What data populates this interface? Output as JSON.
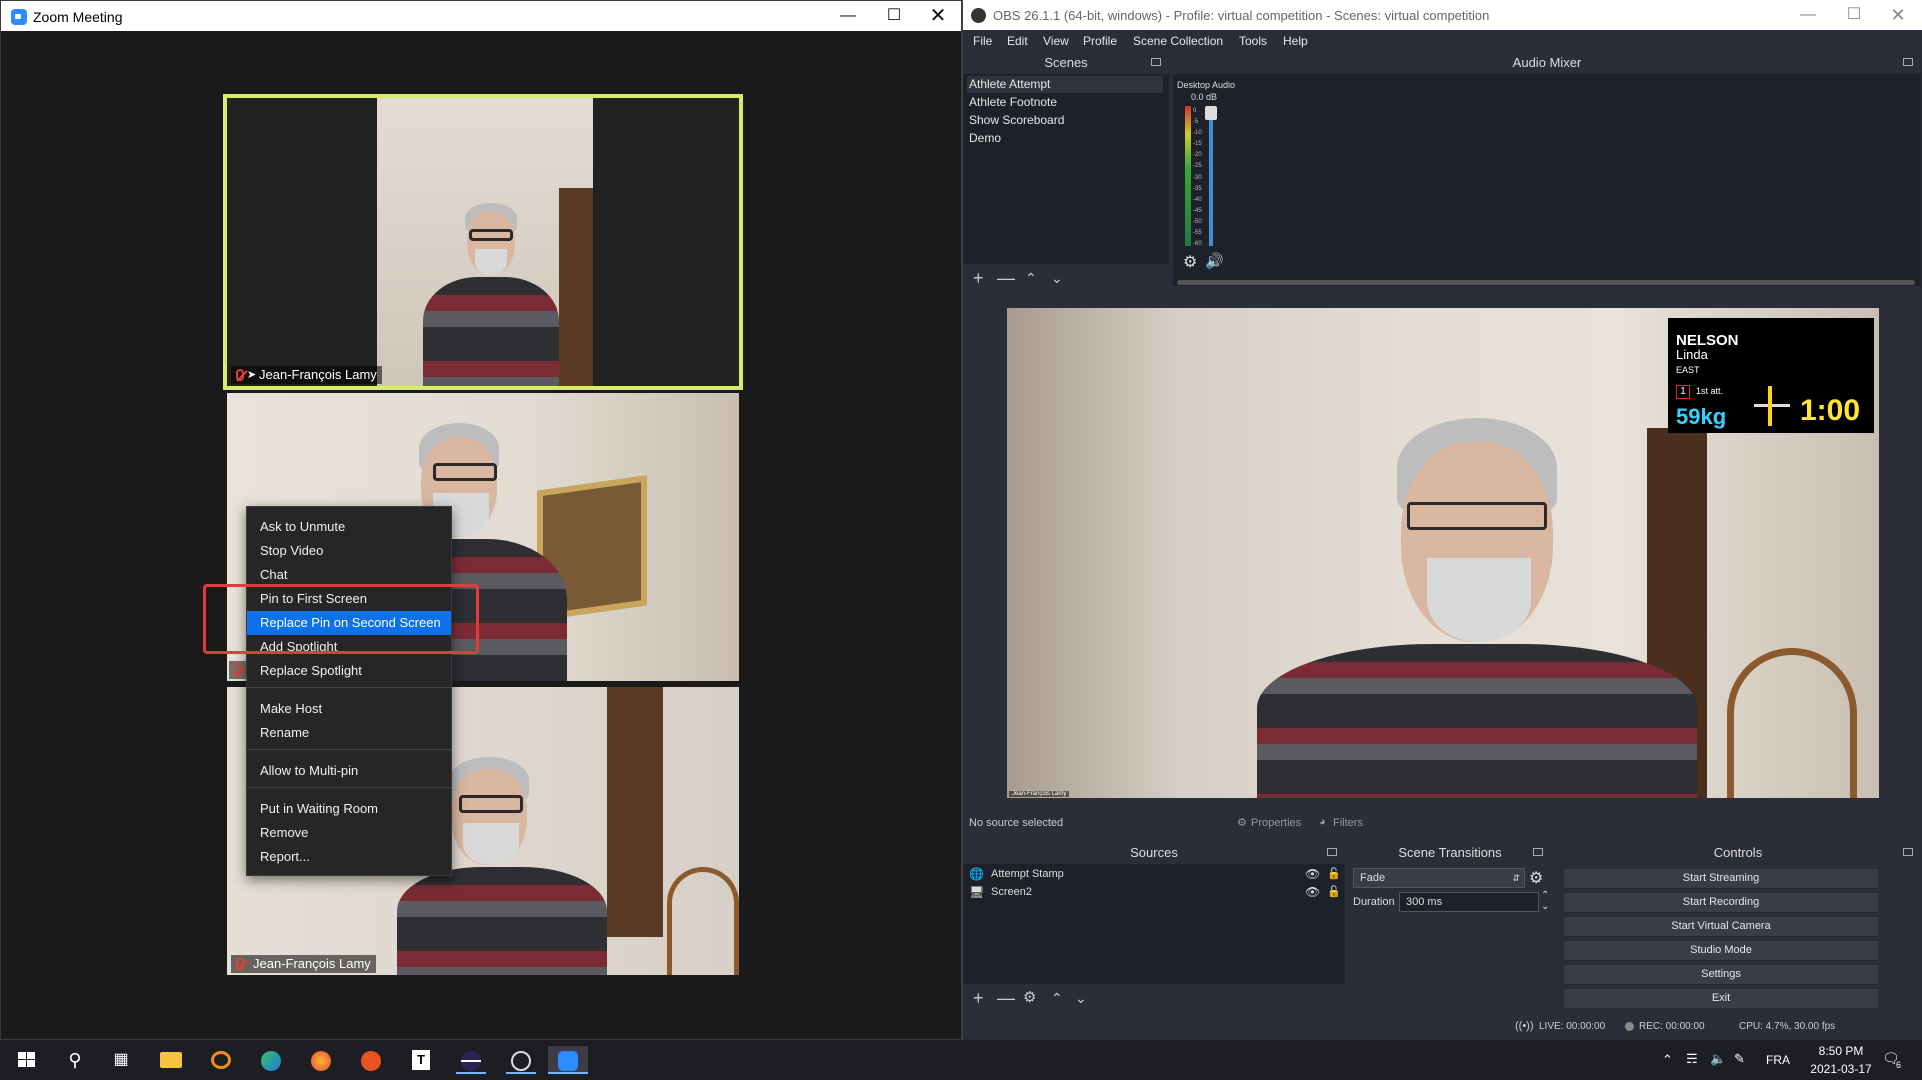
{
  "zoom": {
    "window_title": "Zoom Meeting",
    "participants": [
      {
        "name": "Jean-François Lamy"
      },
      {
        "name": "Jean-François Lamy"
      }
    ],
    "context_menu": {
      "items": [
        "Ask to Unmute",
        "Stop Video",
        "Chat",
        "Pin to First Screen",
        "Replace Pin on Second Screen",
        "Add Spotlight",
        "Replace Spotlight",
        "Make Host",
        "Rename",
        "Allow to Multi-pin",
        "Put in Waiting Room",
        "Remove",
        "Report..."
      ],
      "selected": "Replace Pin on Second Screen"
    }
  },
  "obs": {
    "window_title": "OBS 26.1.1 (64-bit, windows) - Profile: virtual competition - Scenes: virtual competition",
    "menu": [
      "File",
      "Edit",
      "View",
      "Profile",
      "Scene Collection",
      "Tools",
      "Help"
    ],
    "docks": {
      "scenes": "Scenes",
      "audio_mixer": "Audio Mixer",
      "sources": "Sources",
      "scene_transitions": "Scene Transitions",
      "controls": "Controls"
    },
    "scenes": [
      "Athlete Attempt",
      "Athlete Footnote",
      "Show Scoreboard",
      "Demo"
    ],
    "audio": {
      "channel": "Desktop Audio",
      "level": "0.0 dB",
      "scale": [
        "0",
        "-5",
        "-10",
        "-15",
        "-20",
        "-25",
        "-30",
        "-35",
        "-40",
        "-45",
        "-50",
        "-55",
        "-60"
      ]
    },
    "scoreboard": {
      "last_name": "NELSON",
      "first_name": "Linda",
      "team": "EAST",
      "attempt_number": "1",
      "attempt_label": "1st att.",
      "weight": "59kg",
      "clock": "1:00"
    },
    "preview_caption": "Jean-François Lamy",
    "source_status": "No source selected",
    "properties_label": "Properties",
    "filters_label": "Filters",
    "sources": [
      {
        "name": "Attempt Stamp",
        "icon": "globe-icon"
      },
      {
        "name": "Screen2",
        "icon": "monitor-icon"
      }
    ],
    "transition": {
      "type": "Fade",
      "duration_label": "Duration",
      "duration": "300 ms"
    },
    "controls": [
      "Start Streaming",
      "Start Recording",
      "Start Virtual Camera",
      "Studio Mode",
      "Settings",
      "Exit"
    ],
    "status": {
      "live": "LIVE: 00:00:00",
      "rec": "REC: 00:00:00",
      "cpu": "CPU: 4.7%, 30.00 fps"
    }
  },
  "taskbar": {
    "language": "FRA",
    "time": "8:50 PM",
    "date": "2021-03-17",
    "notifications": "6"
  },
  "colors": {
    "zoom_active_border": "#d7ec6f",
    "menu_highlight": "#0e71eb",
    "annotation_red": "#e53a3a",
    "obs_bg": "#2b2e38"
  }
}
